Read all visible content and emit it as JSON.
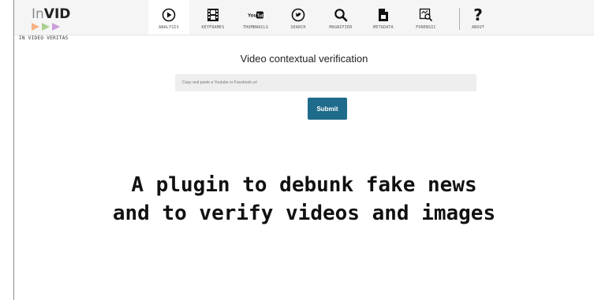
{
  "logo": {
    "prefix": "In",
    "name": "VID",
    "subtitle": "IN VIDEO VERITAS",
    "colors": [
      "#f4b183",
      "#a9d18e",
      "#c9a0dc"
    ]
  },
  "nav": {
    "items": [
      {
        "label": "ANALYSIS",
        "icon": "play-circle-icon",
        "active": true
      },
      {
        "label": "KEYFRAMES",
        "icon": "film-icon",
        "active": false
      },
      {
        "label": "THUMBNAILS",
        "icon": "youtube-icon",
        "active": false
      },
      {
        "label": "SEARCH",
        "icon": "twitter-circle-icon",
        "active": false
      },
      {
        "label": "MAGNIFIER",
        "icon": "magnifier-icon",
        "active": false
      },
      {
        "label": "METADATA",
        "icon": "document-icon",
        "active": false
      },
      {
        "label": "FORENSIC",
        "icon": "forensic-icon",
        "active": false
      },
      {
        "label": "ABOUT",
        "icon": "question-icon",
        "active": false
      }
    ]
  },
  "main": {
    "title": "Video contextual verification",
    "url_placeholder": "Copy and paste a Youtube or Facebook url",
    "submit_label": "Submit"
  },
  "tagline": {
    "line1": "A plugin to debunk fake news",
    "line2": "and to verify videos and images"
  },
  "colors": {
    "submit_bg": "#1f6b8c",
    "topbar_bg": "#f5f5f5",
    "input_bg": "#eeeeee"
  }
}
